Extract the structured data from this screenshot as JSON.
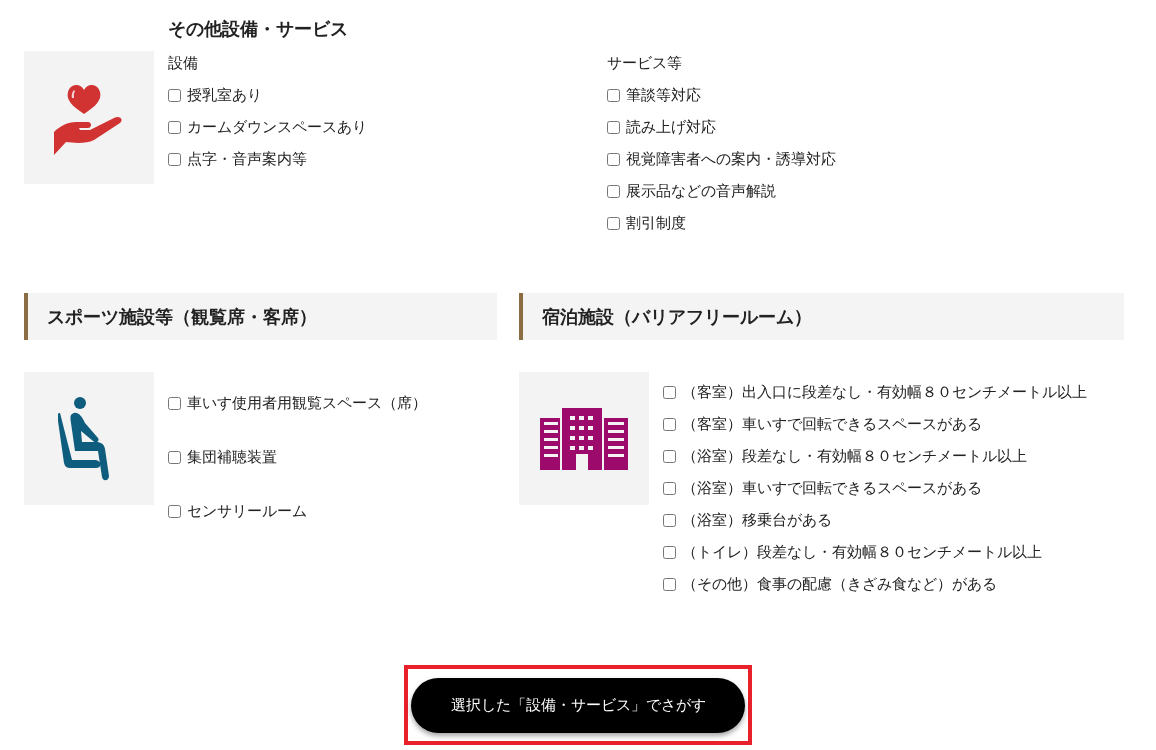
{
  "other": {
    "title": "その他設備・サービス",
    "kind": "heart-hand",
    "columns": [
      {
        "heading": "設備",
        "items": [
          {
            "label": "授乳室あり",
            "checked": false
          },
          {
            "label": "カームダウンスペースあり",
            "checked": false
          },
          {
            "label": "点字・音声案内等",
            "checked": false
          }
        ]
      },
      {
        "heading": "サービス等",
        "items": [
          {
            "label": "筆談等対応",
            "checked": false
          },
          {
            "label": "読み上げ対応",
            "checked": false
          },
          {
            "label": "視覚障害者への案内・誘導対応",
            "checked": false
          },
          {
            "label": "展示品などの音声解説",
            "checked": false
          },
          {
            "label": "割引制度",
            "checked": false
          }
        ]
      }
    ]
  },
  "sections": [
    {
      "title": "スポーツ施設等（観覧席・客席）",
      "kind": "seat",
      "items": [
        {
          "label": "車いす使用者用観覧スペース（席）",
          "checked": false
        },
        {
          "label": "集団補聴装置",
          "checked": false
        },
        {
          "label": "センサリールーム",
          "checked": false
        }
      ]
    },
    {
      "title": "宿泊施設（バリアフリールーム）",
      "kind": "building",
      "items": [
        {
          "label": "（客室）出入口に段差なし・有効幅８０センチメートル以上",
          "checked": false
        },
        {
          "label": "（客室）車いすで回転できるスペースがある",
          "checked": false
        },
        {
          "label": "（浴室）段差なし・有効幅８０センチメートル以上",
          "checked": false
        },
        {
          "label": "（浴室）車いすで回転できるスペースがある",
          "checked": false
        },
        {
          "label": "（浴室）移乗台がある",
          "checked": false
        },
        {
          "label": "（トイレ）段差なし・有効幅８０センチメートル以上",
          "checked": false
        },
        {
          "label": "（その他）食事の配慮（きざみ食など）がある",
          "checked": false
        }
      ]
    }
  ],
  "search_button": {
    "label": "選択した「設備・サービス」でさがす",
    "highlighted": true
  }
}
